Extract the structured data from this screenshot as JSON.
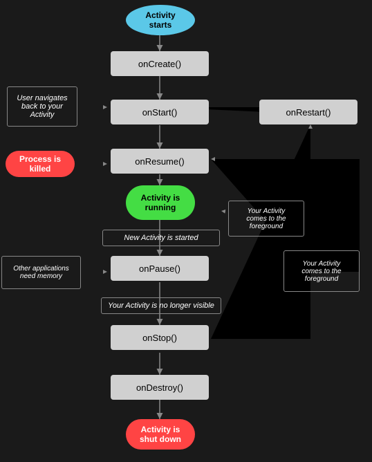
{
  "nodes": {
    "activity_starts": "Activity\nstarts",
    "on_create": "onCreate()",
    "on_start": "onStart()",
    "on_restart": "onRestart()",
    "on_resume": "onResume()",
    "activity_running": "Activity is\nrunning",
    "on_pause": "onPause()",
    "on_stop": "onStop()",
    "on_destroy": "onDestroy()",
    "activity_shut_down": "Activity is\nshut down",
    "new_activity_started": "New Activity is started",
    "user_navigates_back": "User navigates\nback to your\nActivity",
    "process_killed": "Process is\nkilled",
    "other_apps_memory": "Other applications\nneed memory",
    "your_activity_foreground_1": "Your Activity\ncomes to the\nforeground",
    "your_activity_foreground_2": "Your Activity\ncomes to the\nforeground",
    "your_activity_no_longer": "Your Activity is no longer visible"
  }
}
